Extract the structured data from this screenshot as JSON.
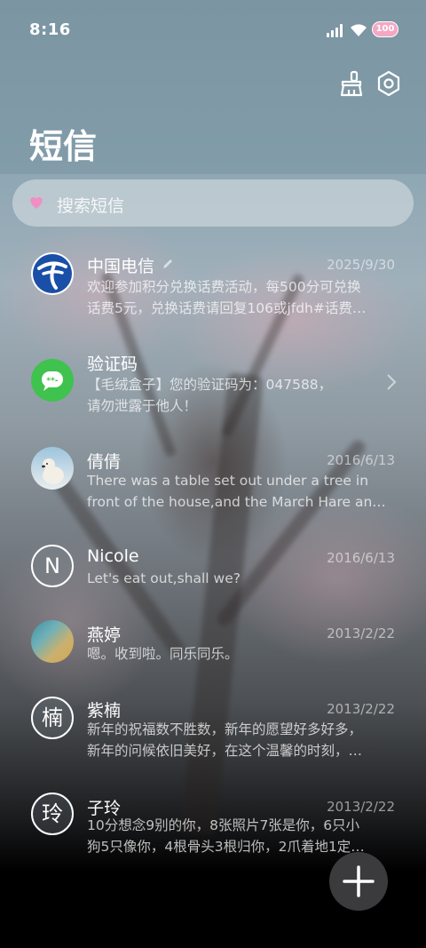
{
  "status_bar": {
    "time": "8:16",
    "battery": "100"
  },
  "header": {
    "title": "短信",
    "clean_icon": "broom-icon",
    "settings_icon": "hexagon-settings-icon"
  },
  "search": {
    "placeholder": "搜索短信",
    "icon": "heart-icon"
  },
  "conversations": [
    {
      "name": "中国电信",
      "date": "2025/9/30",
      "line1": "欢迎参加积分兑换话费活动，每500分可兑换",
      "line2": "话费5元，兑换话费请回复106或jfdh#话费…",
      "avatar": "china-telecom-logo",
      "edit_icon": "pencil-icon"
    },
    {
      "name": "验证码",
      "date": "",
      "line1": "【毛绒盒子】您的验证码为：047588，",
      "line2": "请勿泄露于他人！",
      "avatar": "otp-icon",
      "avatar_color": "#3fc24e"
    },
    {
      "name": "倩倩",
      "date": "2016/6/13",
      "line1": "There was a table set out under a tree in",
      "line2": "front of the house,and the March Hare an…",
      "avatar": "polar-bear-photo"
    },
    {
      "name": "Nicole",
      "date": "2016/6/13",
      "line1": "Let's eat out,shall we?",
      "line2": "",
      "avatar_letter": "N"
    },
    {
      "name": "燕婷",
      "date": "2013/2/22",
      "line1": "嗯。收到啦。同乐同乐。",
      "line2": "",
      "avatar": "landscape-photo"
    },
    {
      "name": "紫楠",
      "date": "2013/2/22",
      "line1": "新年的祝福数不胜数，新年的愿望好多好多，",
      "line2": "新年的问候依旧美好，在这个温馨的时刻，…",
      "avatar_letter": "楠"
    },
    {
      "name": "子玲",
      "date": "2013/2/22",
      "line1": "10分想念9别的你，8张照片7张是你，6只小",
      "line2": "狗5只像你，4根骨头3根归你，2爪着地1定…",
      "avatar_letter": "玲"
    }
  ],
  "fab": {
    "icon": "plus-icon"
  }
}
